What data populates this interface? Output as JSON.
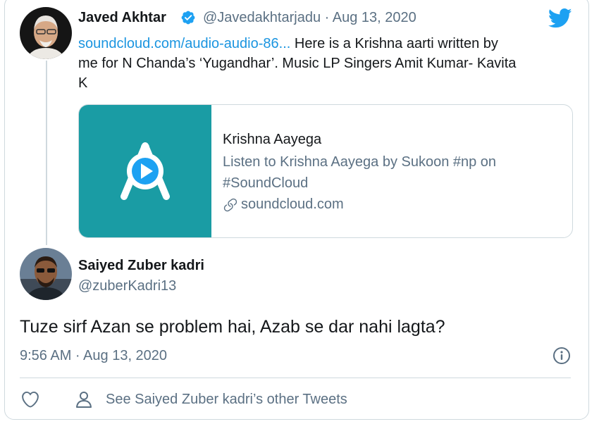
{
  "original_tweet": {
    "author_name": "Javed Akhtar",
    "handle_date": "@Javedakhtarjadu · Aug 13, 2020",
    "link_text": "soundcloud.com/audio-audio-86...",
    "body_line1": " Here is a Krishna aarti written by",
    "body_line2": "me for N Chanda’s ‘Yugandhar’. Music LP Singers Amit Kumar- Kavita",
    "body_line3": "K"
  },
  "embed": {
    "title": "Krishna Aayega",
    "desc_line1": "Listen to Krishna Aayega by Sukoon #np on",
    "desc_line2": "#SoundCloud",
    "domain": "soundcloud.com"
  },
  "reply": {
    "author_name": "Saiyed Zuber kadri",
    "handle": "@zuberKadri13",
    "text": "Tuze sirf Azan se problem hai, Azab se dar nahi lagta?",
    "timestamp": "9:56 AM · Aug 13, 2020"
  },
  "footer": {
    "see_more": "See Saiyed Zuber kadri’s other Tweets"
  },
  "icons": {
    "twitter": "twitter-bird-icon",
    "verified": "verified-badge-icon",
    "info": "info-icon",
    "like": "heart-icon",
    "profile": "person-icon",
    "link": "link-icon",
    "play": "soundcloud-play-icon"
  },
  "colors": {
    "twitter_blue": "#1da1f2",
    "link_blue": "#1b95e0",
    "soundcloud_teal": "#1a9ca4"
  }
}
